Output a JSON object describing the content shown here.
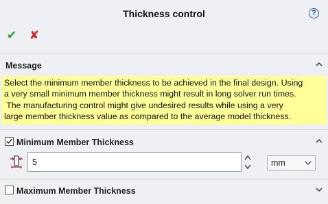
{
  "header": {
    "title": "Thickness control",
    "help_icon": "help-icon",
    "help_glyph": "?"
  },
  "actions": {
    "ok_icon": "checkmark-icon",
    "ok_glyph": "✔",
    "cancel_icon": "x-icon",
    "cancel_glyph": "✘"
  },
  "message_section": {
    "title": "Message",
    "collapse_icon": "chevron-up-icon",
    "lines": [
      "Select the minimum member thickness to be achieved in the final design. Using",
      "a very small minimum member thickness might result in long solver run times.",
      " The manufacturing control might give undesired results while using a very",
      "large member thickness value as compared to the average model thickness."
    ],
    "highlight_color": "#ffff99"
  },
  "minimum_section": {
    "label": "Minimum Member Thickness",
    "checked": true,
    "collapse_icon": "chevron-up-icon",
    "value": "5",
    "value_icon": "thickness-icon",
    "spinner_icon": "spinner-arrows-icon",
    "unit": "mm",
    "unit_icon": "chevron-down-icon"
  },
  "maximum_section": {
    "label": "Maximum Member Thickness",
    "checked": false,
    "expand_icon": "chevron-down-icon"
  }
}
